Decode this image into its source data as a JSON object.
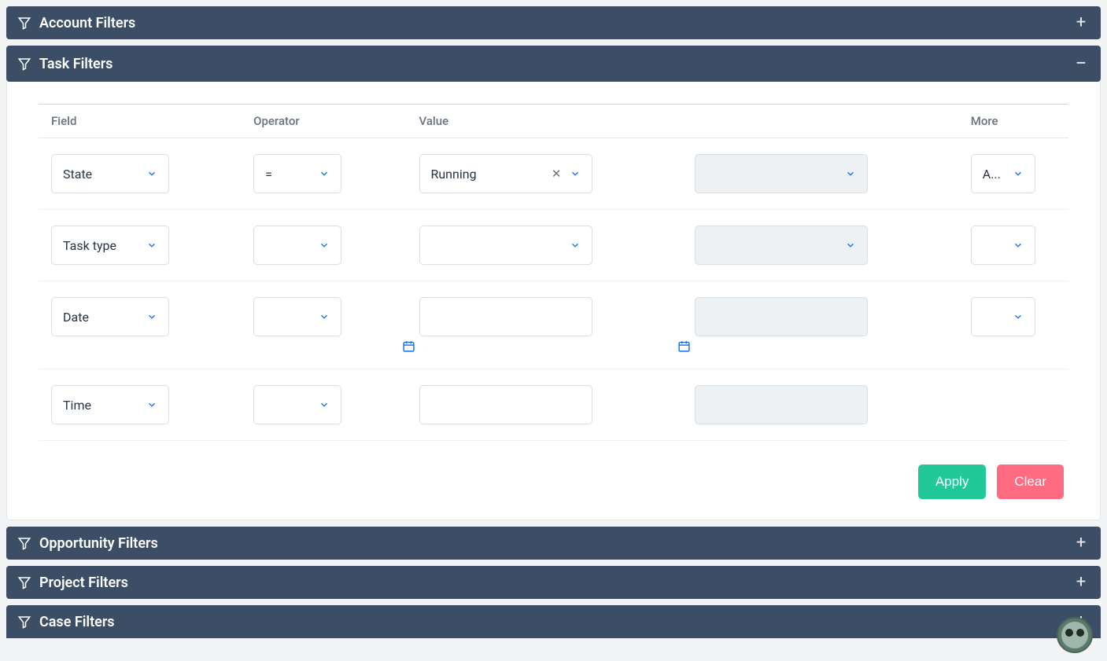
{
  "panels": {
    "account": {
      "title": "Account Filters",
      "expanded": false
    },
    "task": {
      "title": "Task Filters",
      "expanded": true
    },
    "opportunity": {
      "title": "Opportunity Filters",
      "expanded": false
    },
    "project": {
      "title": "Project Filters",
      "expanded": false
    },
    "case": {
      "title": "Case Filters",
      "expanded": false
    }
  },
  "columns": {
    "field": "Field",
    "operator": "Operator",
    "value": "Value",
    "more": "More"
  },
  "rows": [
    {
      "field": "State",
      "operator": "=",
      "value": "Running",
      "value_clearable": true,
      "value2_disabled": true,
      "more": "A...",
      "has_more": true,
      "date": false
    },
    {
      "field": "Task type",
      "operator": "",
      "value": "",
      "value_clearable": false,
      "value2_disabled": true,
      "more": "",
      "has_more": true,
      "date": false
    },
    {
      "field": "Date",
      "operator": "",
      "value": "",
      "value_clearable": false,
      "value2_disabled": true,
      "more": "",
      "has_more": true,
      "date": true
    },
    {
      "field": "Time",
      "operator": "",
      "value": "",
      "value_clearable": false,
      "value2_disabled": true,
      "more": "",
      "has_more": false,
      "date": false,
      "plain_input": true
    }
  ],
  "buttons": {
    "apply": "Apply",
    "clear": "Clear"
  }
}
